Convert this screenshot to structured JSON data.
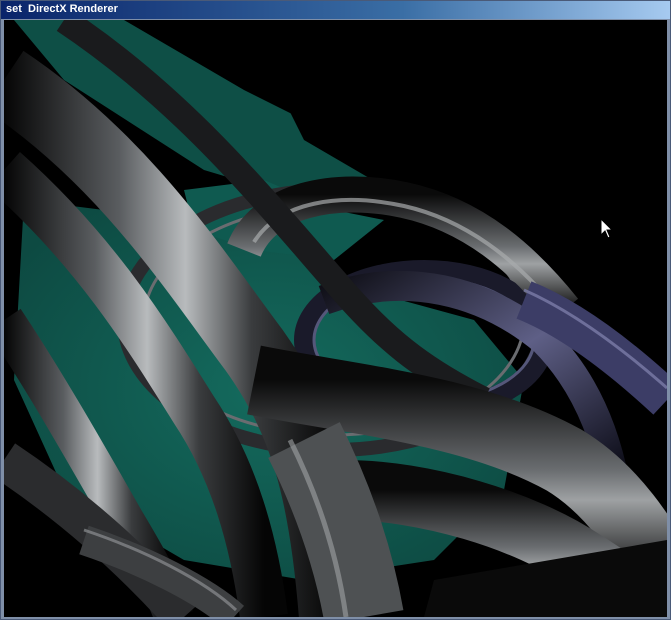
{
  "window": {
    "title": "set  DirectX Renderer"
  },
  "scene": {
    "background_color": "#000000",
    "accent_color": "#135a50",
    "tube_color": "#8a8d90",
    "highlight_color": "#4a4a78"
  },
  "cursor": {
    "icon": "arrow-cursor-icon"
  }
}
